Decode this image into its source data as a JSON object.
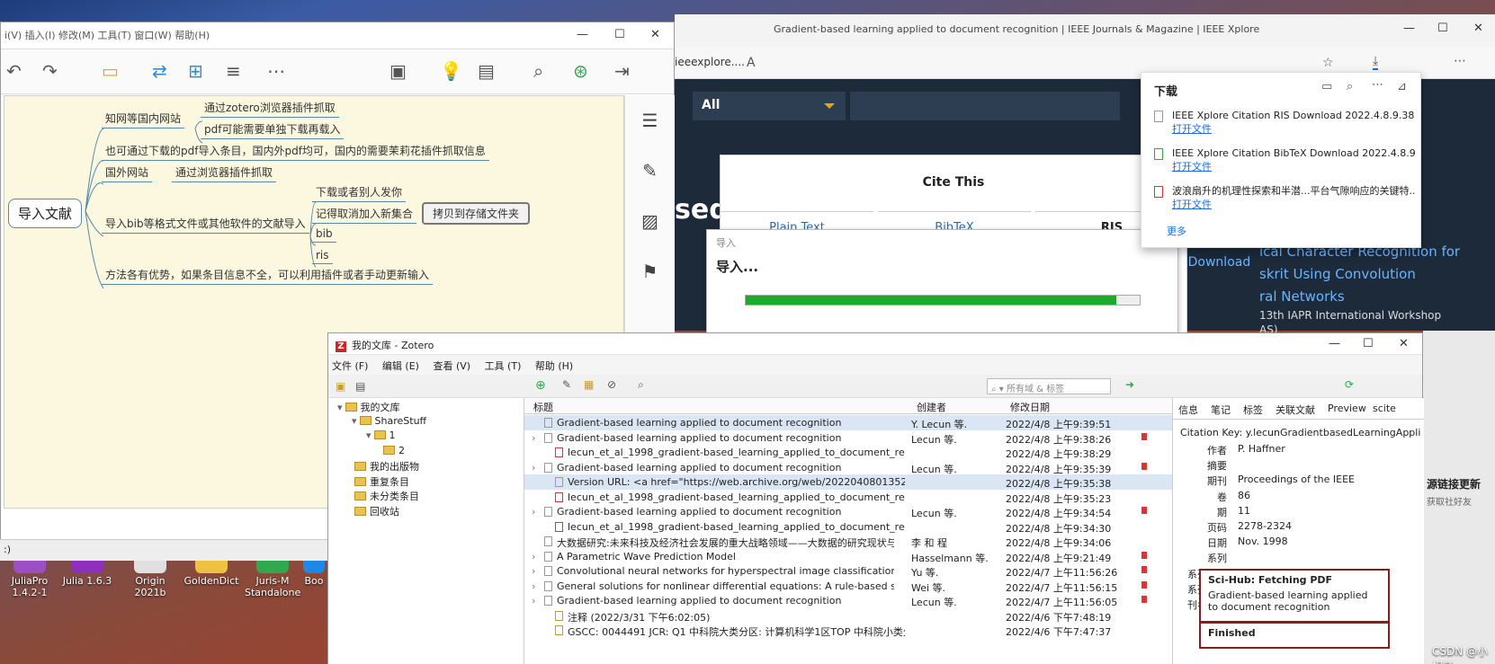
{
  "desktop": {
    "apps": [
      {
        "label": "JuliaPro\n1.4.2-1",
        "color": "#9c4fc4"
      },
      {
        "label": "Julia 1.6.3",
        "color": "#8f2fbf"
      },
      {
        "label": "Origin\n2021b",
        "color": "#e0e0e0"
      },
      {
        "label": "GoldenDict",
        "color": "#f0c040"
      },
      {
        "label": "Juris-M\nStandalone",
        "color": "#2fa84f"
      },
      {
        "label": "Boo",
        "color": "#1e88e5"
      }
    ]
  },
  "mindmap": {
    "title_fragment": "i(V)  插入(I)  修改(M)  工具(T)  窗口(W)  帮助(H)",
    "root": "导入文献",
    "nodes": {
      "n1": "知网等国内网站",
      "n1a": "通过zotero浏览器插件抓取",
      "n1b": "pdf可能需要单独下载再载入",
      "n2": "也可通过下载的pdf导入条目，国内外pdf均可，国内的需要茉莉花插件抓取信息",
      "n3": "国外网站",
      "n3a": "通过浏览器插件抓取",
      "n4": "导入bib等格式文件或其他软件的文献导入",
      "n4a": "下载或者别人发你",
      "n4b": "记得取消加入新集合",
      "n4b1": "拷贝到存储文件夹",
      "n4c": "bib",
      "n4d": "ris",
      "n5": "方法各有优势，如果条目信息不全，可以利用插件或者手动更新输入"
    },
    "status": ":)"
  },
  "browser": {
    "title": "Gradient-based learning applied to document recognition | IEEE Journals & Magazine | IEEE Xplore",
    "address": "ieeexplore....",
    "search_scope": "All",
    "paper_title_lines": [
      "ical Character Recognition for",
      "skrit Using Convolution",
      "ral Networks",
      "13th IAPR International Workshop",
      "AS)"
    ],
    "side_text": "sed",
    "download_btn": "Download"
  },
  "cite": {
    "title": "Cite This",
    "tabs": [
      "Plain Text",
      "BibTeX",
      "RIS"
    ]
  },
  "import_dialog": {
    "header": "导入",
    "title": "导入...",
    "progress": 0.94
  },
  "downloads": {
    "title": "下载",
    "items": [
      {
        "name": "IEEE Xplore Citation RIS Download 2022.4.8.9.38.51...",
        "action": "打开文件"
      },
      {
        "name": "IEEE Xplore Citation BibTeX Download 2022.4.8.9.3...",
        "action": "打开文件"
      },
      {
        "name": "波浪扇升的机理性探索和半潜...平台气隙响应的关键特...",
        "action": "打开文件"
      }
    ],
    "more": "更多"
  },
  "zotero": {
    "title": "我的文库 - Zotero",
    "menu": [
      "文件 (F)",
      "编辑 (E)",
      "查看 (V)",
      "工具 (T)",
      "帮助 (H)"
    ],
    "search_placeholder": "所有域 & 标签",
    "collections": [
      {
        "label": "我的文库",
        "indent": 0
      },
      {
        "label": "ShareStuff",
        "indent": 1
      },
      {
        "label": "1",
        "indent": 2
      },
      {
        "label": "2",
        "indent": 3
      },
      {
        "label": "我的出版物",
        "indent": 1
      },
      {
        "label": "重复条目",
        "indent": 1
      },
      {
        "label": "未分类条目",
        "indent": 1
      },
      {
        "label": "回收站",
        "indent": 1
      }
    ],
    "columns": [
      "标题",
      "创建者",
      "修改日期"
    ],
    "rows": [
      {
        "title": "Gradient-based learning applied to document recognition",
        "creator": "Y. Lecun 等.",
        "date": "2022/4/8 上午9:39:51",
        "selected": true,
        "child": false,
        "pdf": false
      },
      {
        "title": "Gradient-based learning applied to document recognition",
        "creator": "Lecun 等.",
        "date": "2022/4/8 上午9:38:26",
        "child": false,
        "pdf": true
      },
      {
        "title": "lecun_et_al_1998_gradient-based_learning_applied_to_document_recog...",
        "creator": "",
        "date": "2022/4/8 上午9:38:29",
        "child": true,
        "pdf": true
      },
      {
        "title": "Gradient-based learning applied to document recognition",
        "creator": "Lecun 等.",
        "date": "2022/4/8 上午9:35:39",
        "child": false,
        "pdf": true
      },
      {
        "title": "Version URL: <a href=\"https://web.archive.org/web/20220408013521/h...",
        "creator": "",
        "date": "2022/4/8 上午9:35:38",
        "child": true,
        "pdf": false,
        "hl": true
      },
      {
        "title": "lecun_et_al_1998_gradient-based_learning_applied_to_document_recog...",
        "creator": "",
        "date": "2022/4/8 上午9:35:23",
        "child": true,
        "pdf": true
      },
      {
        "title": "Gradient-based learning applied to document recognition",
        "creator": "Lecun 等.",
        "date": "2022/4/8 上午9:34:54",
        "child": false,
        "pdf": true
      },
      {
        "title": "lecun_et_al_1998_gradient-based_learning_applied_to_document_recog...",
        "creator": "",
        "date": "2022/4/8 上午9:34:30",
        "child": true,
        "pdf": true
      },
      {
        "title": "大数据研究:未来科技及经济社会发展的重大战略领域——大数据的研究现状与...",
        "creator": "李 和 程",
        "date": "2022/4/8 上午9:34:06",
        "child": false,
        "pdf": false
      },
      {
        "title": "A Parametric Wave Prediction Model",
        "creator": "Hasselmann 等.",
        "date": "2022/4/8 上午9:21:49",
        "child": false,
        "pdf": true
      },
      {
        "title": "Convolutional neural networks for hyperspectral image classification",
        "creator": "Yu 等.",
        "date": "2022/4/7 上午11:56:26",
        "child": false,
        "pdf": true
      },
      {
        "title": "General solutions for nonlinear differential equations: A rule-based self-le...",
        "creator": "Wei 等.",
        "date": "2022/4/7 上午11:56:15",
        "child": false,
        "pdf": true
      },
      {
        "title": "Gradient-based learning applied to document recognition",
        "creator": "Lecun 等.",
        "date": "2022/4/7 上午11:56:05",
        "child": false,
        "pdf": true
      },
      {
        "title": "注释 (2022/3/31 下午6:02:05)",
        "creator": "",
        "date": "2022/4/6 下午7:48:19",
        "child": true,
        "pdf": false
      },
      {
        "title": "GSCC: 0044491 JCR: Q1 中科院大类分区: 计算机科学1区TOP 中科院小类分...",
        "creator": "",
        "date": "2022/4/6 下午7:47:37",
        "child": true,
        "pdf": false
      }
    ],
    "info_tabs": [
      "信息",
      "笔记",
      "标签",
      "关联文献",
      "Preview",
      "scite"
    ],
    "citation_key": "Citation Key: y.lecunGradientbasedLearningApplied1998",
    "fields": [
      {
        "k": "作者",
        "v": "P. Haffner"
      },
      {
        "k": "摘要",
        "v": ""
      },
      {
        "k": "期刊",
        "v": "Proceedings of the IEEE"
      },
      {
        "k": "卷",
        "v": "86"
      },
      {
        "k": "期",
        "v": "11"
      },
      {
        "k": "页码",
        "v": "2278-2324"
      },
      {
        "k": "日期",
        "v": "Nov. 1998"
      },
      {
        "k": "系列",
        "v": ""
      },
      {
        "k": "系列标题",
        "v": ""
      },
      {
        "k": "系列文本",
        "v": ""
      },
      {
        "k": "刊名缩写",
        "v": ""
      },
      {
        "k": "语言",
        "v": ""
      },
      {
        "k": "DO",
        "v": ""
      }
    ],
    "date_suffix": "m y",
    "scihub_title": "Sci-Hub: Fetching PDF",
    "scihub_body": "Gradient-based learning applied to document recognition",
    "finished": "Finished"
  },
  "right_edge": {
    "text": "源链接更新",
    "text2": "获取社好友"
  },
  "watermark": "CSDN @小蜗子"
}
